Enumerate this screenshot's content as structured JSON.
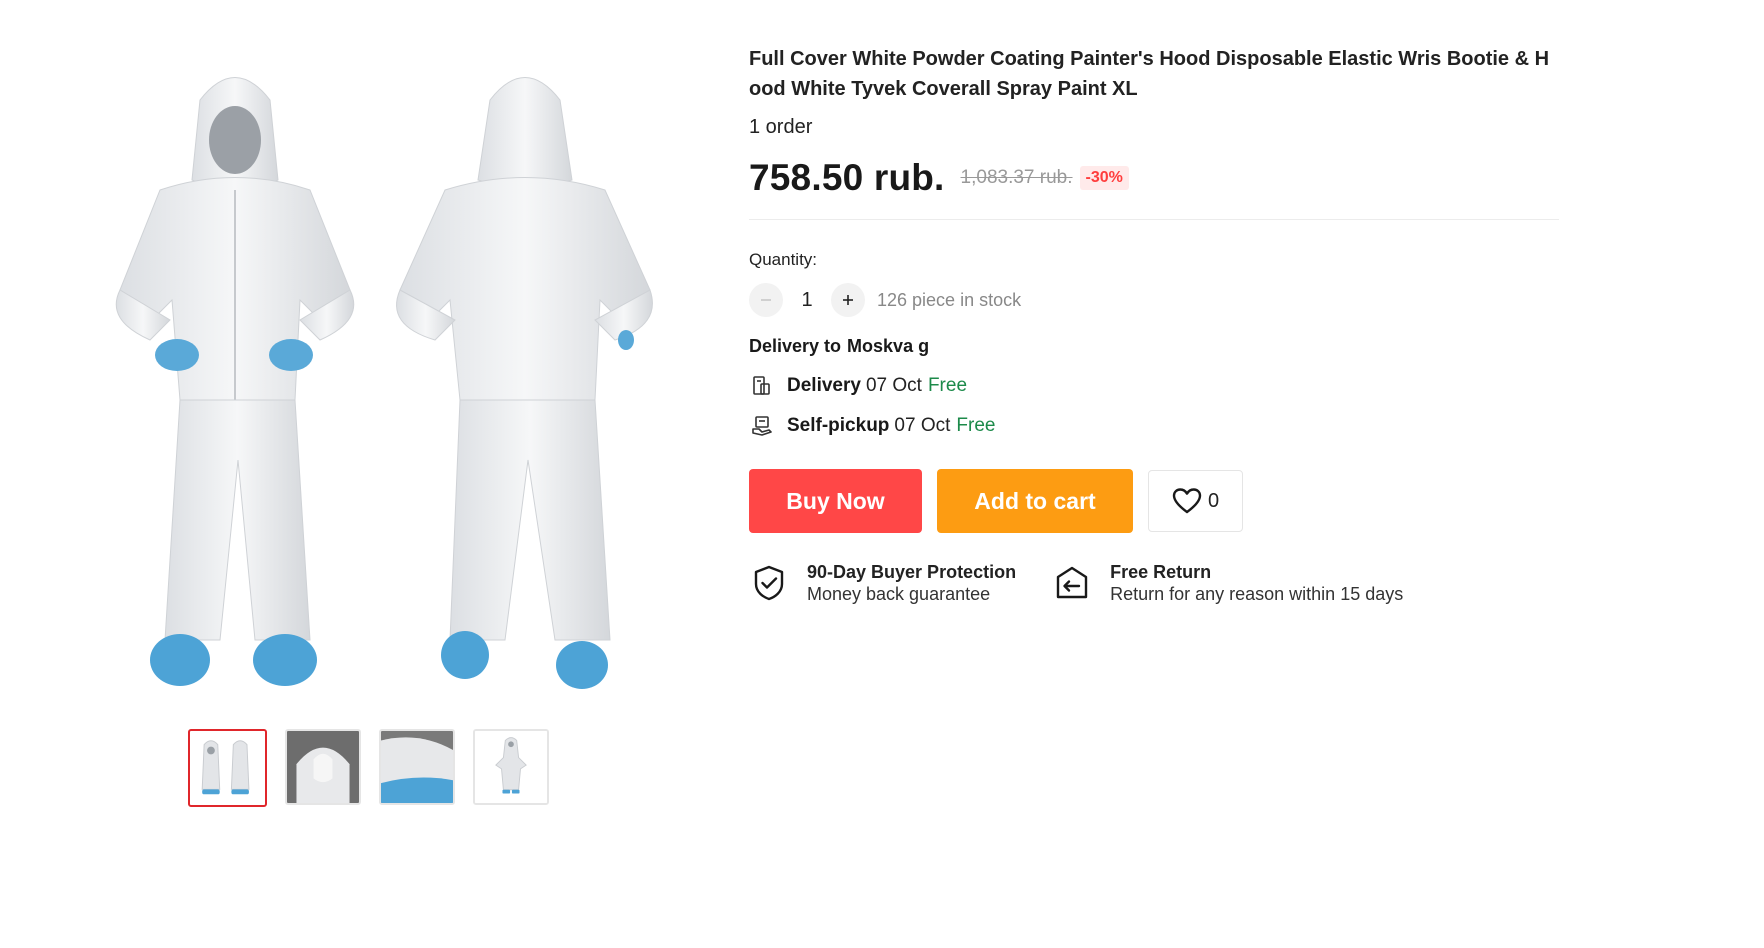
{
  "product": {
    "title": "Full Cover White Powder Coating Painter's Hood Disposable Elastic Wris Bootie & Hood White Tyvek Coverall Spray Paint XL",
    "orders": "1 order",
    "price": "758.50 rub.",
    "old_price": "1,083.37 rub.",
    "discount": "-30%"
  },
  "gallery": {
    "main_image": "coverall-front-back",
    "thumbnails": [
      {
        "name": "coverall-front-back",
        "active": true
      },
      {
        "name": "hood-closeup",
        "active": false
      },
      {
        "name": "bootie-closeup",
        "active": false
      },
      {
        "name": "coverall-single",
        "active": false
      }
    ]
  },
  "quantity": {
    "label": "Quantity:",
    "minus_icon": "minus-icon",
    "value": "1",
    "plus_icon": "plus-icon",
    "stock": "126 piece in stock"
  },
  "delivery": {
    "to_label": "Delivery to",
    "city": "Moskva g",
    "options": [
      {
        "icon": "delivery-icon",
        "label": "Delivery",
        "date": "07 Oct",
        "price": "Free"
      },
      {
        "icon": "self-pickup-icon",
        "label": "Self-pickup",
        "date": "07 Oct",
        "price": "Free"
      }
    ]
  },
  "actions": {
    "buy_now": "Buy Now",
    "add_to_cart": "Add to cart",
    "wishlist_count": "0",
    "wishlist_icon": "heart-icon"
  },
  "guarantees": [
    {
      "icon": "shield-check-icon",
      "title": "90-Day Buyer Protection",
      "subtitle": "Money back guarantee"
    },
    {
      "icon": "return-icon",
      "title": "Free Return",
      "subtitle": "Return for any reason within 15 days"
    }
  ],
  "colors": {
    "buy_now": "#ff4747",
    "add_to_cart": "#fd9c12",
    "free": "#1c8a4a",
    "discount": "#ff3d3d",
    "active_thumb_border": "#e0262b"
  }
}
